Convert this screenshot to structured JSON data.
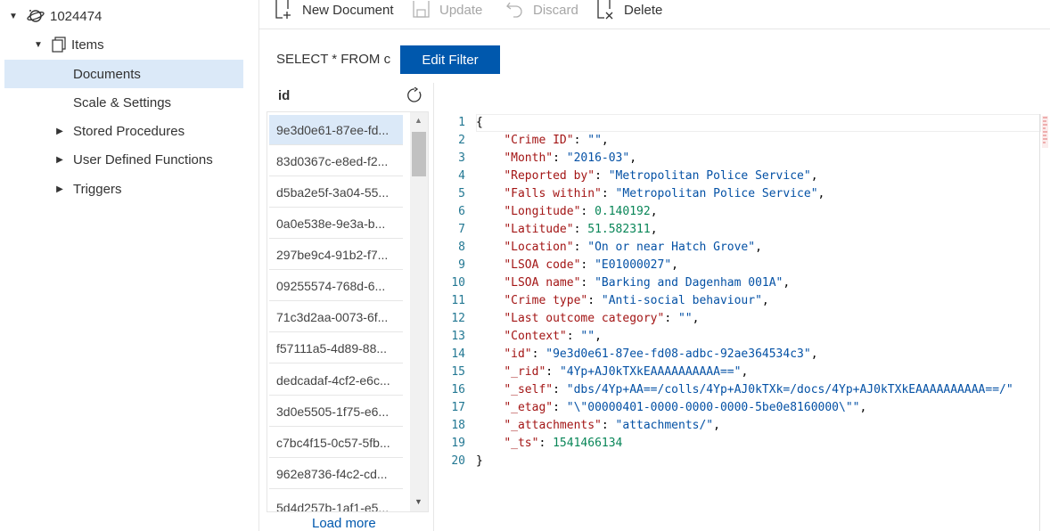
{
  "tree": {
    "account": "1024474",
    "collection": "Items",
    "items": [
      {
        "label": "Documents",
        "selected": true
      },
      {
        "label": "Scale & Settings",
        "selected": false
      },
      {
        "label": "Stored Procedures",
        "selected": false
      },
      {
        "label": "User Defined Functions",
        "selected": false
      },
      {
        "label": "Triggers",
        "selected": false
      }
    ]
  },
  "toolbar": {
    "new_document": "New Document",
    "update": "Update",
    "discard": "Discard",
    "delete": "Delete"
  },
  "filter": {
    "query": "SELECT * FROM c",
    "edit_button": "Edit Filter"
  },
  "list": {
    "header": "id",
    "ids": [
      "9e3d0e61-87ee-fd...",
      "83d0367c-e8ed-f2...",
      "d5ba2e5f-3a04-55...",
      "0a0e538e-9e3a-b...",
      "297be9c4-91b2-f7...",
      "09255574-768d-6...",
      "71c3d2aa-0073-6f...",
      "f57111a5-4d89-88...",
      "dedcadaf-4cf2-e6c...",
      "3d0e5505-1f75-e6...",
      "c7bc4f15-0c57-5fb...",
      "962e8736-f4c2-cd...",
      "5d4d257b-1af1-e5..."
    ],
    "load_more": "Load more"
  },
  "editor": {
    "lines": [
      {
        "n": "1",
        "tokens": [
          {
            "t": "p",
            "v": "{"
          }
        ]
      },
      {
        "n": "2",
        "tokens": [
          {
            "t": "p",
            "v": "    "
          },
          {
            "t": "k",
            "v": "\"Crime ID\""
          },
          {
            "t": "p",
            "v": ": "
          },
          {
            "t": "s",
            "v": "\"\""
          },
          {
            "t": "p",
            "v": ","
          }
        ]
      },
      {
        "n": "3",
        "tokens": [
          {
            "t": "p",
            "v": "    "
          },
          {
            "t": "k",
            "v": "\"Month\""
          },
          {
            "t": "p",
            "v": ": "
          },
          {
            "t": "s",
            "v": "\"2016-03\""
          },
          {
            "t": "p",
            "v": ","
          }
        ]
      },
      {
        "n": "4",
        "tokens": [
          {
            "t": "p",
            "v": "    "
          },
          {
            "t": "k",
            "v": "\"Reported by\""
          },
          {
            "t": "p",
            "v": ": "
          },
          {
            "t": "s",
            "v": "\"Metropolitan Police Service\""
          },
          {
            "t": "p",
            "v": ","
          }
        ]
      },
      {
        "n": "5",
        "tokens": [
          {
            "t": "p",
            "v": "    "
          },
          {
            "t": "k",
            "v": "\"Falls within\""
          },
          {
            "t": "p",
            "v": ": "
          },
          {
            "t": "s",
            "v": "\"Metropolitan Police Service\""
          },
          {
            "t": "p",
            "v": ","
          }
        ]
      },
      {
        "n": "6",
        "tokens": [
          {
            "t": "p",
            "v": "    "
          },
          {
            "t": "k",
            "v": "\"Longitude\""
          },
          {
            "t": "p",
            "v": ": "
          },
          {
            "t": "n",
            "v": "0.140192"
          },
          {
            "t": "p",
            "v": ","
          }
        ]
      },
      {
        "n": "7",
        "tokens": [
          {
            "t": "p",
            "v": "    "
          },
          {
            "t": "k",
            "v": "\"Latitude\""
          },
          {
            "t": "p",
            "v": ": "
          },
          {
            "t": "n",
            "v": "51.582311"
          },
          {
            "t": "p",
            "v": ","
          }
        ]
      },
      {
        "n": "8",
        "tokens": [
          {
            "t": "p",
            "v": "    "
          },
          {
            "t": "k",
            "v": "\"Location\""
          },
          {
            "t": "p",
            "v": ": "
          },
          {
            "t": "s",
            "v": "\"On or near Hatch Grove\""
          },
          {
            "t": "p",
            "v": ","
          }
        ]
      },
      {
        "n": "9",
        "tokens": [
          {
            "t": "p",
            "v": "    "
          },
          {
            "t": "k",
            "v": "\"LSOA code\""
          },
          {
            "t": "p",
            "v": ": "
          },
          {
            "t": "s",
            "v": "\"E01000027\""
          },
          {
            "t": "p",
            "v": ","
          }
        ]
      },
      {
        "n": "10",
        "tokens": [
          {
            "t": "p",
            "v": "    "
          },
          {
            "t": "k",
            "v": "\"LSOA name\""
          },
          {
            "t": "p",
            "v": ": "
          },
          {
            "t": "s",
            "v": "\"Barking and Dagenham 001A\""
          },
          {
            "t": "p",
            "v": ","
          }
        ]
      },
      {
        "n": "11",
        "tokens": [
          {
            "t": "p",
            "v": "    "
          },
          {
            "t": "k",
            "v": "\"Crime type\""
          },
          {
            "t": "p",
            "v": ": "
          },
          {
            "t": "s",
            "v": "\"Anti-social behaviour\""
          },
          {
            "t": "p",
            "v": ","
          }
        ]
      },
      {
        "n": "12",
        "tokens": [
          {
            "t": "p",
            "v": "    "
          },
          {
            "t": "k",
            "v": "\"Last outcome category\""
          },
          {
            "t": "p",
            "v": ": "
          },
          {
            "t": "s",
            "v": "\"\""
          },
          {
            "t": "p",
            "v": ","
          }
        ]
      },
      {
        "n": "13",
        "tokens": [
          {
            "t": "p",
            "v": "    "
          },
          {
            "t": "k",
            "v": "\"Context\""
          },
          {
            "t": "p",
            "v": ": "
          },
          {
            "t": "s",
            "v": "\"\""
          },
          {
            "t": "p",
            "v": ","
          }
        ]
      },
      {
        "n": "14",
        "tokens": [
          {
            "t": "p",
            "v": "    "
          },
          {
            "t": "k",
            "v": "\"id\""
          },
          {
            "t": "p",
            "v": ": "
          },
          {
            "t": "s",
            "v": "\"9e3d0e61-87ee-fd08-adbc-92ae364534c3\""
          },
          {
            "t": "p",
            "v": ","
          }
        ]
      },
      {
        "n": "15",
        "tokens": [
          {
            "t": "p",
            "v": "    "
          },
          {
            "t": "k",
            "v": "\"_rid\""
          },
          {
            "t": "p",
            "v": ": "
          },
          {
            "t": "s",
            "v": "\"4Yp+AJ0kTXkEAAAAAAAAAA==\""
          },
          {
            "t": "p",
            "v": ","
          }
        ]
      },
      {
        "n": "16",
        "tokens": [
          {
            "t": "p",
            "v": "    "
          },
          {
            "t": "k",
            "v": "\"_self\""
          },
          {
            "t": "p",
            "v": ": "
          },
          {
            "t": "s",
            "v": "\"dbs/4Yp+AA==/colls/4Yp+AJ0kTXk=/docs/4Yp+AJ0kTXkEAAAAAAAAAA==/\""
          }
        ]
      },
      {
        "n": "17",
        "tokens": [
          {
            "t": "p",
            "v": "    "
          },
          {
            "t": "k",
            "v": "\"_etag\""
          },
          {
            "t": "p",
            "v": ": "
          },
          {
            "t": "s",
            "v": "\"\\\"00000401-0000-0000-0000-5be0e8160000\\\"\""
          },
          {
            "t": "p",
            "v": ","
          }
        ]
      },
      {
        "n": "18",
        "tokens": [
          {
            "t": "p",
            "v": "    "
          },
          {
            "t": "k",
            "v": "\"_attachments\""
          },
          {
            "t": "p",
            "v": ": "
          },
          {
            "t": "s",
            "v": "\"attachments/\""
          },
          {
            "t": "p",
            "v": ","
          }
        ]
      },
      {
        "n": "19",
        "tokens": [
          {
            "t": "p",
            "v": "    "
          },
          {
            "t": "k",
            "v": "\"_ts\""
          },
          {
            "t": "p",
            "v": ": "
          },
          {
            "t": "n",
            "v": "1541466134"
          }
        ]
      },
      {
        "n": "20",
        "tokens": [
          {
            "t": "p",
            "v": "}"
          }
        ]
      }
    ]
  },
  "colors": {
    "accent": "#0058ad",
    "selection": "#dbe9f8",
    "json_key": "#a31515",
    "json_string": "#0451a5",
    "json_number": "#098658",
    "line_number": "#237893"
  }
}
